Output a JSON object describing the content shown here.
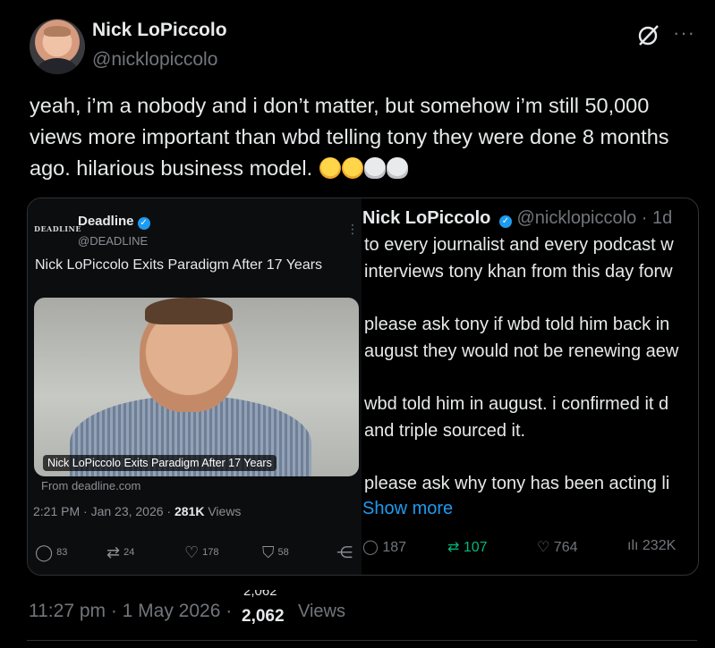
{
  "author": {
    "name": "Nick LoPiccolo",
    "handle": "@nicklopiccolo"
  },
  "tweet": {
    "text": "yeah, i’m a nobody and i don’t matter, but somehow i’m still 50,000 views more important than wbd telling tony they were done 8 months ago. hilarious business model.",
    "emojis": [
      "rolling-on-floor-laughing",
      "rolling-on-floor-laughing",
      "skull",
      "skull"
    ]
  },
  "embedded_left": {
    "logo": "DEADLINE",
    "name": "Deadline",
    "handle": "@DEADLINE",
    "headline": "Nick LoPiccolo Exits Paradigm After 17 Years",
    "photo_caption": "Nick LoPiccolo Exits Paradigm After 17 Years",
    "from": "From deadline.com",
    "time": "2:21 PM · Jan 23, 2026 · ",
    "views_count": "281K",
    "views_label": " Views",
    "actions": {
      "replies": "83",
      "reposts": "24",
      "likes": "178",
      "bookmarks": "58"
    }
  },
  "embedded_right": {
    "name": "Nick LoPiccolo",
    "handle": "@nicklopiccolo · 1d",
    "lines": [
      "to every journalist and every podcast w",
      "interviews tony khan from this day forw",
      "please ask tony if wbd told him back in",
      "august they would not be renewing aew",
      "wbd told him in august. i confirmed it d",
      "and triple sourced it.",
      "please ask why tony has been acting li"
    ],
    "show_more": "Show more",
    "stats": {
      "replies": "187",
      "reposts": "107",
      "likes": "764",
      "views": "232K"
    }
  },
  "footer": {
    "time": "11:27 pm · 1 May 2026 ·",
    "views_count": "2,062",
    "views_label": "Views"
  },
  "colors": {
    "background": "#000000",
    "text": "#e7e9ea",
    "muted": "#71767b",
    "accent": "#1d9bf0",
    "repost_green": "#00ba7c"
  }
}
